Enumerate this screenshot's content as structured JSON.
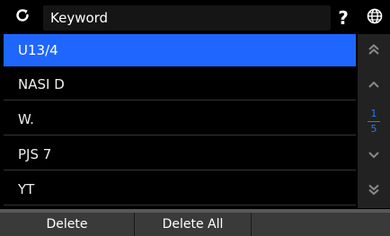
{
  "header": {
    "search_text": "Keyword",
    "help_label": "?"
  },
  "list": {
    "items": [
      {
        "label": "U13/4",
        "selected": true
      },
      {
        "label": "NASI D",
        "selected": false
      },
      {
        "label": "W.",
        "selected": false
      },
      {
        "label": "PJS 7",
        "selected": false
      },
      {
        "label": "YT",
        "selected": false
      }
    ]
  },
  "pager": {
    "current": "1",
    "total": "5"
  },
  "footer": {
    "delete_label": "Delete",
    "delete_all_label": "Delete All"
  },
  "colors": {
    "accent": "#1f66ff",
    "pager": "#1e7cff"
  },
  "icons": [
    "refresh-icon",
    "help-icon",
    "globe-icon",
    "double-chevron-up-icon",
    "chevron-up-icon",
    "chevron-down-icon",
    "double-chevron-down-icon"
  ]
}
